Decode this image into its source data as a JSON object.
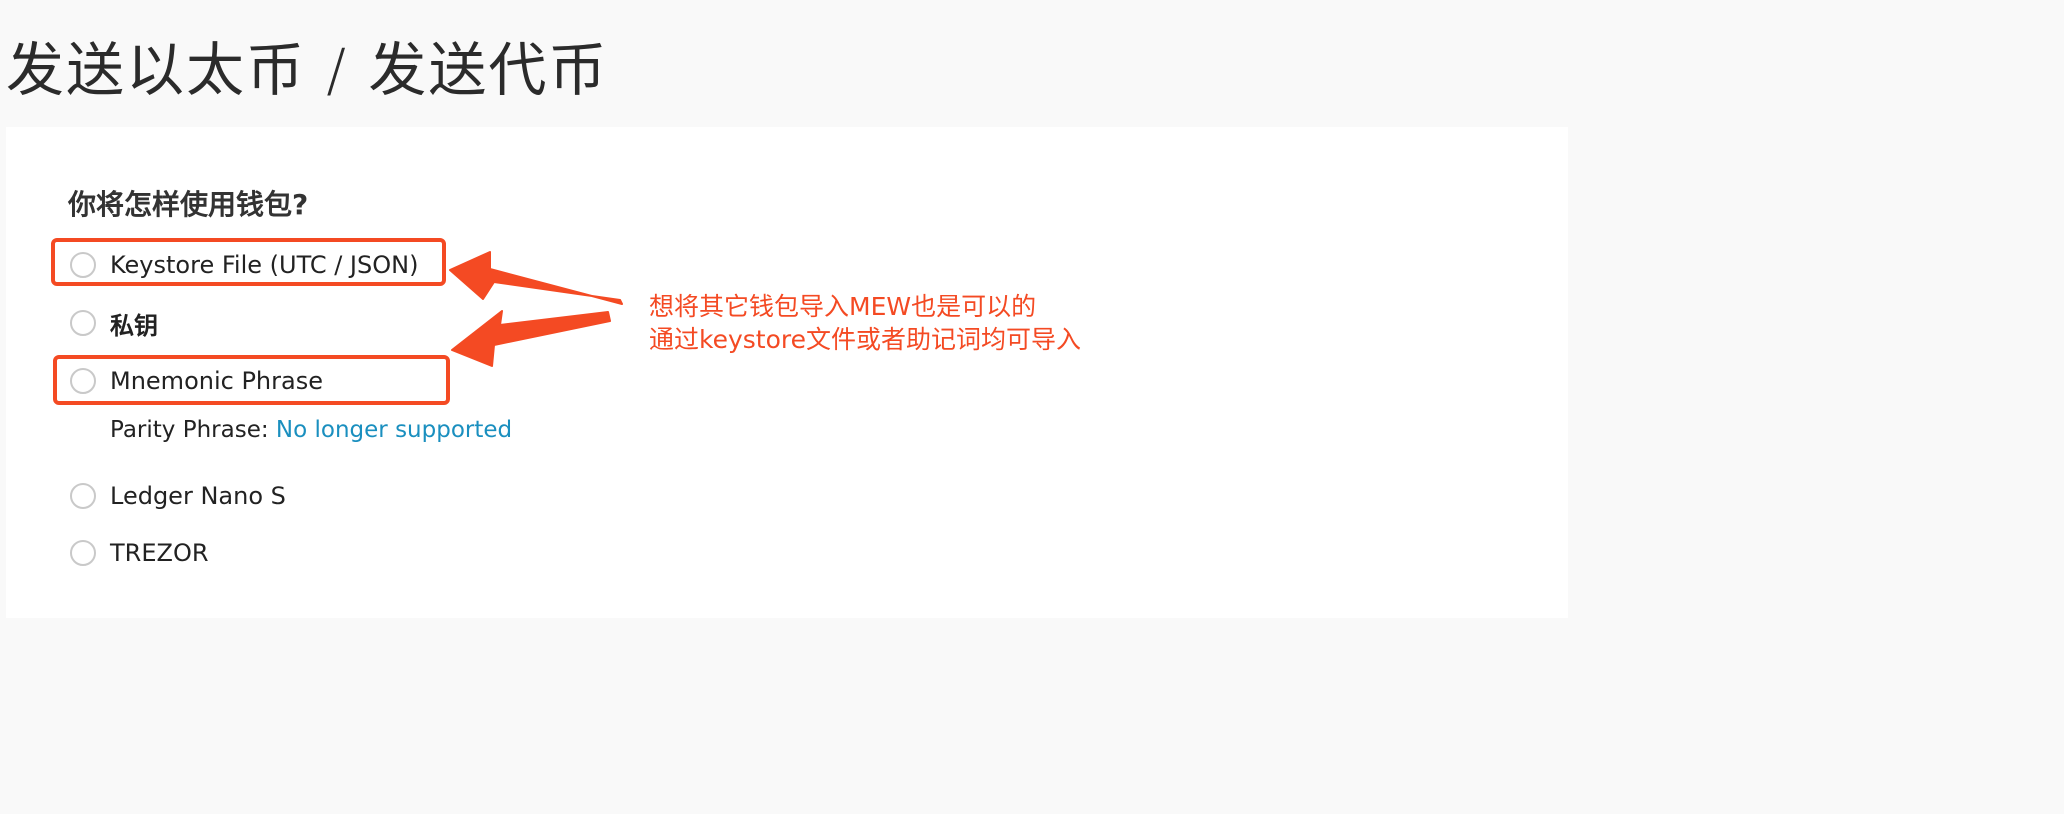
{
  "header": {
    "title": "发送以太币 / 发送代币"
  },
  "wallet_access": {
    "question": "你将怎样使用钱包?",
    "options": [
      {
        "label": "Keystore File (UTC / JSON)",
        "selected": false
      },
      {
        "label": "私钥",
        "selected": false
      },
      {
        "label": "Mnemonic Phrase",
        "selected": false
      },
      {
        "label": "Ledger Nano S",
        "selected": false
      },
      {
        "label": "TREZOR",
        "selected": false
      }
    ],
    "parity_note": {
      "label": "Parity Phrase: ",
      "link": "No longer supported"
    }
  },
  "annotation": {
    "line1": "想将其它钱包导入MEW也是可以的",
    "line2": "通过keystore文件或者助记词均可导入",
    "color": "#f44a23"
  },
  "colors": {
    "link": "#1a8fbf",
    "radio_border": "#c9c9c9",
    "header_bg": "#f9f9f9",
    "panel_bg": "#ffffff"
  }
}
